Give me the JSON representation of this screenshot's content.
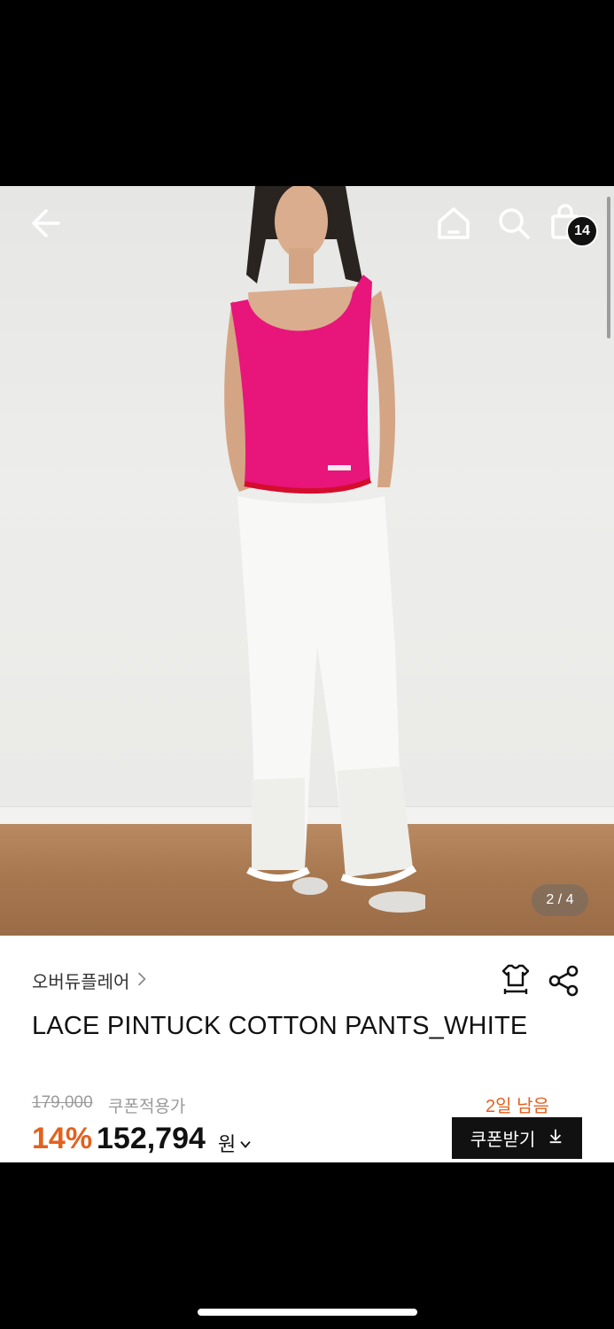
{
  "header": {
    "cart_count": "14"
  },
  "gallery": {
    "pager": "2 / 4"
  },
  "product": {
    "brand": "오버듀플레어",
    "title": "LACE PINTUCK COTTON PANTS_WHITE",
    "original_price": "179,000",
    "coupon_label": "쿠폰적용가",
    "discount": "14%",
    "price": "152,794",
    "currency": "원",
    "days_left": "2일 남음",
    "coupon_button": "쿠폰받기"
  },
  "colors": {
    "accent": "#e2611f",
    "dark": "#111111",
    "top_pink": "#e8157a"
  },
  "icons": [
    "back-arrow-icon",
    "home-icon",
    "search-icon",
    "shopping-bag-icon",
    "chevron-right-icon",
    "size-guide-icon",
    "share-icon",
    "chevron-down-icon",
    "download-icon"
  ]
}
